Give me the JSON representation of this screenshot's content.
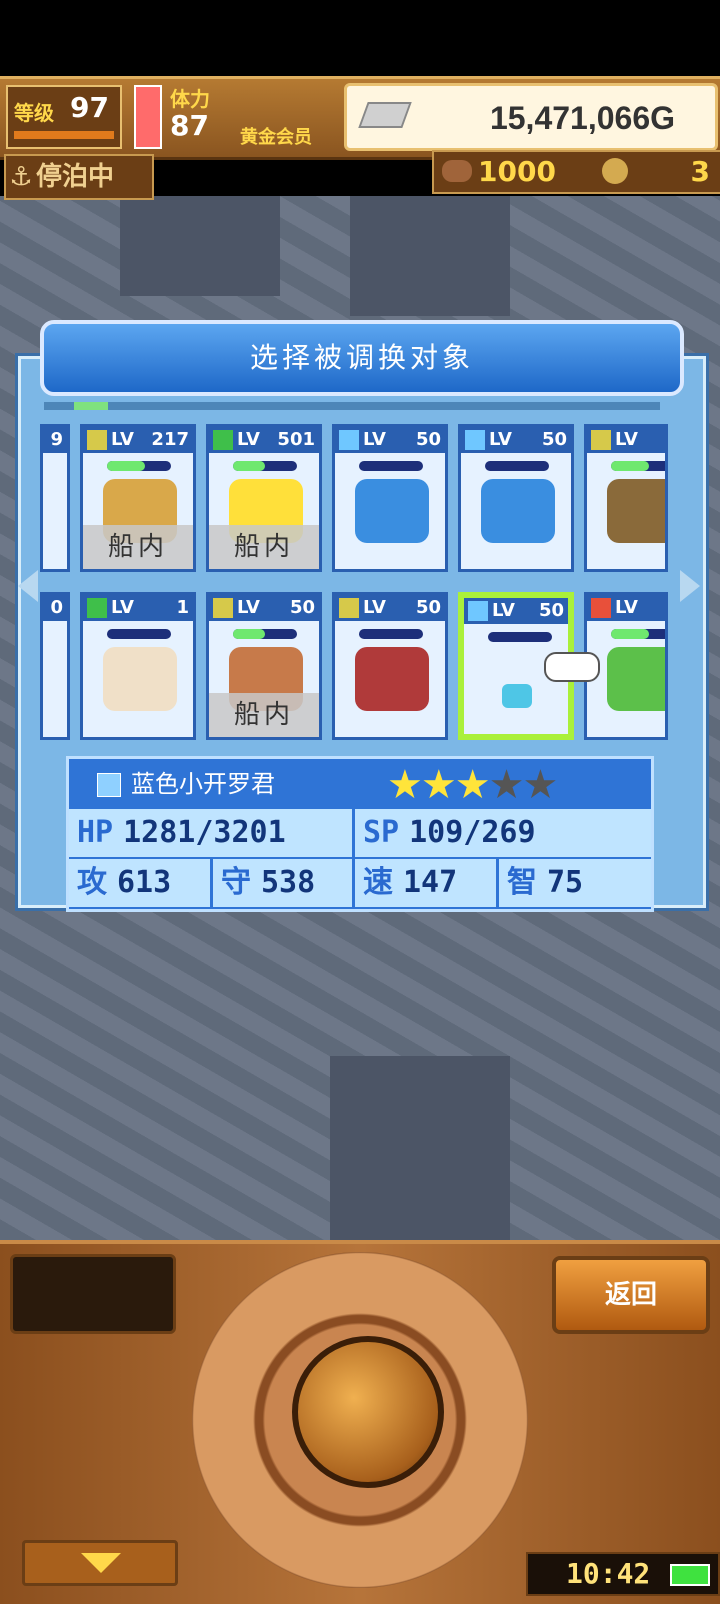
{
  "hud": {
    "level_label": "等级",
    "level_value": "97",
    "stamina_label": "体力",
    "stamina_value": "87",
    "membership": "黄金会员",
    "money": "15,471,066G",
    "status": "停泊中",
    "coin_a": "1000",
    "coin_b": "3"
  },
  "dialog": {
    "title": "选择被调换对象",
    "ship_label": "船内",
    "cards": [
      {
        "lv_label": "LV",
        "level": "217",
        "elem": "yellow",
        "hp": 0.6,
        "in_ship": true
      },
      {
        "lv_label": "LV",
        "level": "501",
        "elem": "green",
        "hp": 0.5,
        "in_ship": true
      },
      {
        "lv_label": "LV",
        "level": "50",
        "elem": "blue",
        "hp": 0.0,
        "in_ship": false
      },
      {
        "lv_label": "LV",
        "level": "50",
        "elem": "blue",
        "hp": 0.0,
        "in_ship": false
      },
      {
        "lv_label": "LV",
        "level": "",
        "elem": "yellow",
        "hp": 0.6,
        "in_ship": false
      },
      {
        "lv_label": "LV",
        "level": "1",
        "elem": "green",
        "hp": 0.0,
        "in_ship": false
      },
      {
        "lv_label": "LV",
        "level": "50",
        "elem": "yellow",
        "hp": 0.5,
        "in_ship": true
      },
      {
        "lv_label": "LV",
        "level": "50",
        "elem": "yellow",
        "hp": 0.0,
        "in_ship": false
      },
      {
        "lv_label": "LV",
        "level": "50",
        "elem": "blue",
        "hp": 0.0,
        "in_ship": false,
        "selected": true
      },
      {
        "lv_label": "LV",
        "level": "",
        "elem": "red",
        "hp": 0.6,
        "in_ship": false
      }
    ],
    "left_edge_top": "9",
    "left_edge_bottom": "0"
  },
  "info": {
    "name": "蓝色小开罗君",
    "stars_filled": 3,
    "stars_total": 5,
    "stats": {
      "hp_label": "HP",
      "hp": "1281/3201",
      "sp_label": "SP",
      "sp": "109/269",
      "atk_label": "攻",
      "atk": "613",
      "def_label": "守",
      "def": "538",
      "spd_label": "速",
      "spd": "147",
      "int_label": "智",
      "int": "75"
    }
  },
  "controls": {
    "back_label": "返回",
    "clock": "10:42"
  },
  "colors": {
    "elem_yellow": "#d6c94a",
    "elem_green": "#3fbf4a",
    "elem_blue": "#6fc7ff",
    "elem_red": "#e8503a",
    "selected_border": "#aaf03a"
  },
  "icons": {
    "anchor": "anchor-icon",
    "ingot": "silver-ingot-icon",
    "hand": "pointing-hand-icon",
    "battery": "battery-icon"
  }
}
